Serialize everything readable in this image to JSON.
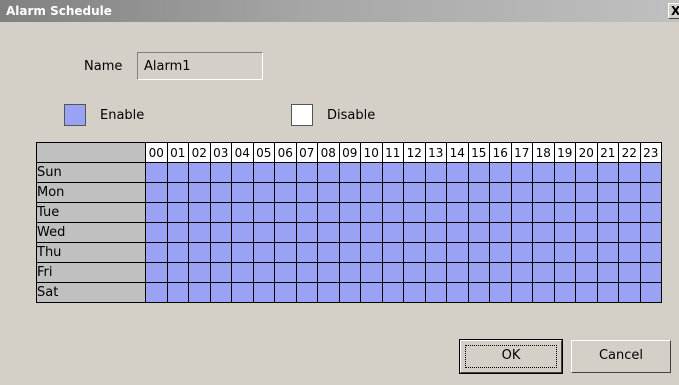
{
  "window": {
    "title": "Alarm Schedule",
    "close_glyph": "X"
  },
  "name": {
    "label": "Name",
    "value": "Alarm1"
  },
  "legend": {
    "enable_label": "Enable",
    "disable_label": "Disable",
    "enable_color": "#9aa2f4",
    "disable_color": "#ffffff"
  },
  "schedule": {
    "hours": [
      "00",
      "01",
      "02",
      "03",
      "04",
      "05",
      "06",
      "07",
      "08",
      "09",
      "10",
      "11",
      "12",
      "13",
      "14",
      "15",
      "16",
      "17",
      "18",
      "19",
      "20",
      "21",
      "22",
      "23"
    ],
    "days": [
      {
        "label": "Sun",
        "enabled": [
          1,
          1,
          1,
          1,
          1,
          1,
          1,
          1,
          1,
          1,
          1,
          1,
          1,
          1,
          1,
          1,
          1,
          1,
          1,
          1,
          1,
          1,
          1,
          1
        ]
      },
      {
        "label": "Mon",
        "enabled": [
          1,
          1,
          1,
          1,
          1,
          1,
          1,
          1,
          1,
          1,
          1,
          1,
          1,
          1,
          1,
          1,
          1,
          1,
          1,
          1,
          1,
          1,
          1,
          1
        ]
      },
      {
        "label": "Tue",
        "enabled": [
          1,
          1,
          1,
          1,
          1,
          1,
          1,
          1,
          1,
          1,
          1,
          1,
          1,
          1,
          1,
          1,
          1,
          1,
          1,
          1,
          1,
          1,
          1,
          1
        ]
      },
      {
        "label": "Wed",
        "enabled": [
          1,
          1,
          1,
          1,
          1,
          1,
          1,
          1,
          1,
          1,
          1,
          1,
          1,
          1,
          1,
          1,
          1,
          1,
          1,
          1,
          1,
          1,
          1,
          1
        ]
      },
      {
        "label": "Thu",
        "enabled": [
          1,
          1,
          1,
          1,
          1,
          1,
          1,
          1,
          1,
          1,
          1,
          1,
          1,
          1,
          1,
          1,
          1,
          1,
          1,
          1,
          1,
          1,
          1,
          1
        ]
      },
      {
        "label": "Fri",
        "enabled": [
          1,
          1,
          1,
          1,
          1,
          1,
          1,
          1,
          1,
          1,
          1,
          1,
          1,
          1,
          1,
          1,
          1,
          1,
          1,
          1,
          1,
          1,
          1,
          1
        ]
      },
      {
        "label": "Sat",
        "enabled": [
          1,
          1,
          1,
          1,
          1,
          1,
          1,
          1,
          1,
          1,
          1,
          1,
          1,
          1,
          1,
          1,
          1,
          1,
          1,
          1,
          1,
          1,
          1,
          1
        ]
      }
    ]
  },
  "buttons": {
    "ok_label": "OK",
    "cancel_label": "Cancel"
  }
}
